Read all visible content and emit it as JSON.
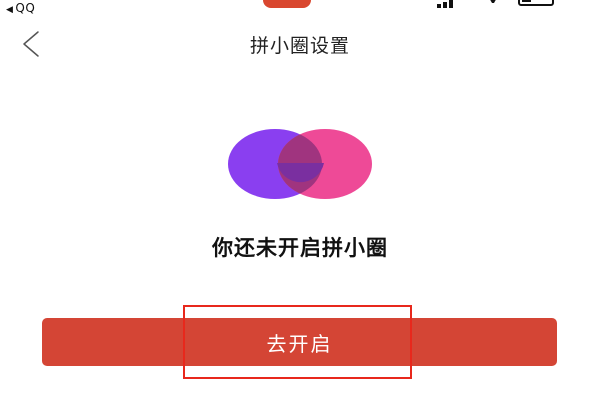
{
  "status_bar": {
    "back_app_arrow": "◀",
    "back_app_label": "QQ"
  },
  "nav": {
    "back_icon": "chevron-left-icon",
    "title": "拼小圈设置"
  },
  "logo": {
    "icon": "pinxiaoquan-logo-icon",
    "left_color": "#8a3ff0",
    "right_color": "#ee4a97",
    "overlap_color": "#a0347f"
  },
  "empty_state": {
    "message": "你还未开启拼小圈"
  },
  "primary_button": {
    "label": "去开启",
    "color": "#d44535"
  },
  "annotation": {
    "highlight_color": "#e8281c"
  }
}
